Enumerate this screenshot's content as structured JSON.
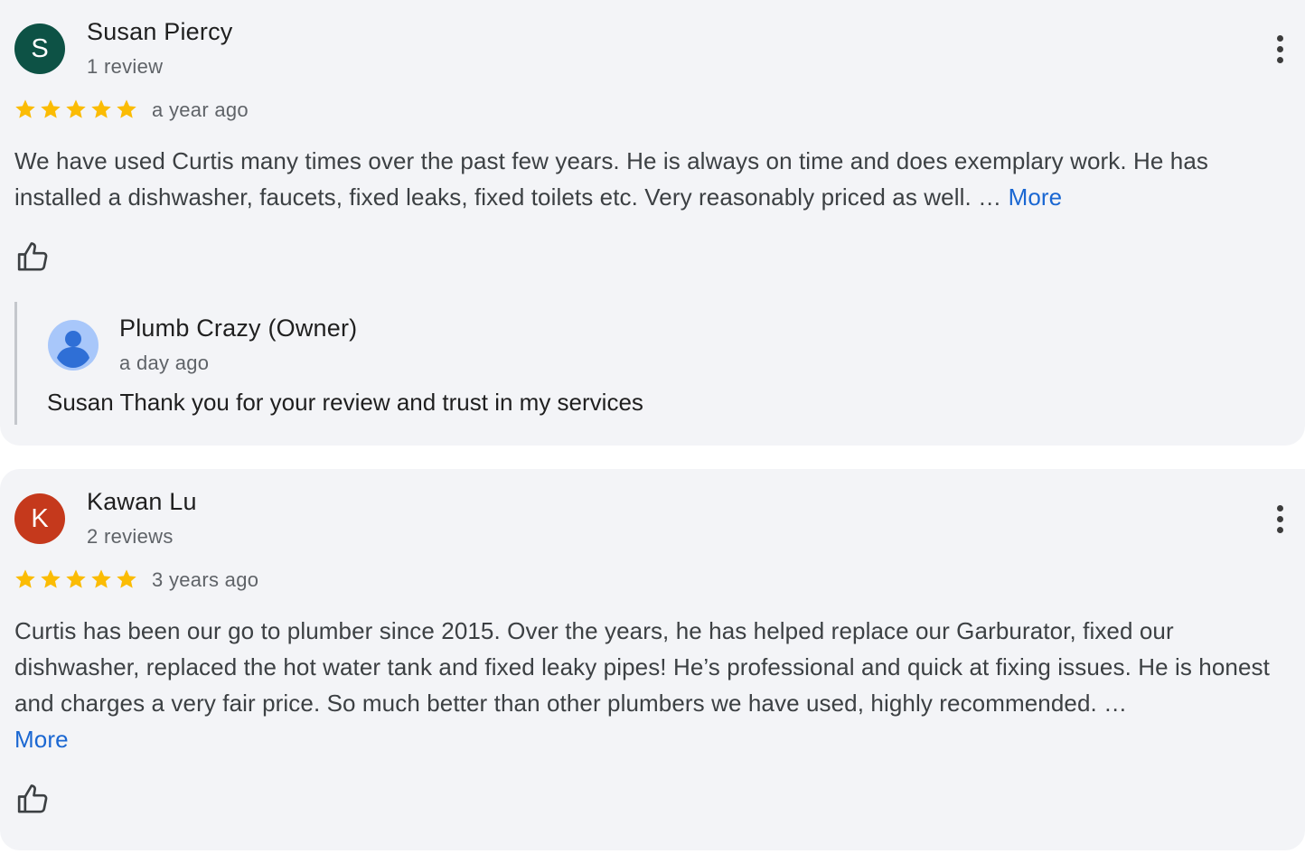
{
  "reviews": [
    {
      "avatar_letter": "S",
      "avatar_color": "#0d5245",
      "name": "Susan Piercy",
      "review_count": "1 review",
      "rating": 5,
      "time_ago": "a year ago",
      "text": "We have used Curtis many times over the past few years. He is always on time and does exemplary work. He has installed a dishwasher, faucets, fixed leaks, fixed toilets etc. Very reasonably priced as well. … ",
      "more_label": "More",
      "menu_icon": "more-vert-icon",
      "like_icon": "thumbs-up-icon",
      "owner_reply": {
        "name": "Plumb Crazy (Owner)",
        "time_ago": "a day ago",
        "text": "Susan Thank you for your review and trust in my services",
        "avatar_icon": "default-person-avatar-icon"
      }
    },
    {
      "avatar_letter": "K",
      "avatar_color": "#c5391c",
      "name": "Kawan Lu",
      "review_count": "2 reviews",
      "rating": 5,
      "time_ago": "3 years ago",
      "text": "Curtis has been our go to plumber since 2015. Over the years, he has helped replace our Garburator, fixed our dishwasher, replaced the hot water tank and fixed leaky pipes! He’s professional and quick at fixing issues. He is honest and charges a very fair price. So much better than other plumbers we have used, highly recommended. …",
      "more_label": "More",
      "menu_icon": "more-vert-icon",
      "like_icon": "thumbs-up-icon"
    }
  ],
  "colors": {
    "star": "#fbbc04",
    "link": "#1a67d2",
    "card_background": "#f3f4f7"
  }
}
